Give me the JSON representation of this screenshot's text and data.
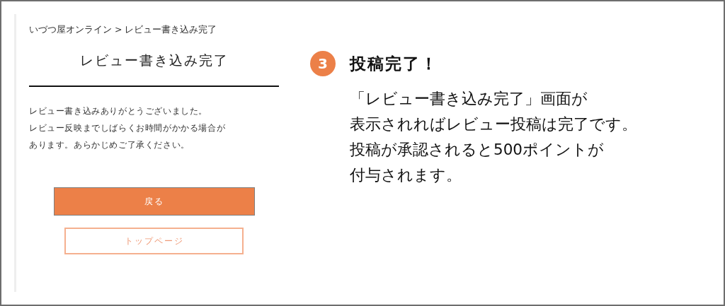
{
  "screen": {
    "breadcrumb": "いづつ屋オンライン > レビュー書き込み完了",
    "heading": "レビュー書き込み完了",
    "message_lines": [
      "レビュー書き込みありがとうございました。",
      "レビュー反映までしばらくお時間がかかる場合が",
      "あります。あらかじめご了承ください。"
    ],
    "buttons": [
      {
        "label": "戻る",
        "kind": "primary"
      },
      {
        "label": "トップページ",
        "kind": "outline"
      }
    ]
  },
  "step": {
    "number": "3",
    "title": "投稿完了！",
    "lines": [
      "「レビュー書き込み完了」画面が",
      "表示されればレビュー投稿は完了です。",
      "投稿が承認されると500ポイントが",
      "付与されます。"
    ]
  }
}
